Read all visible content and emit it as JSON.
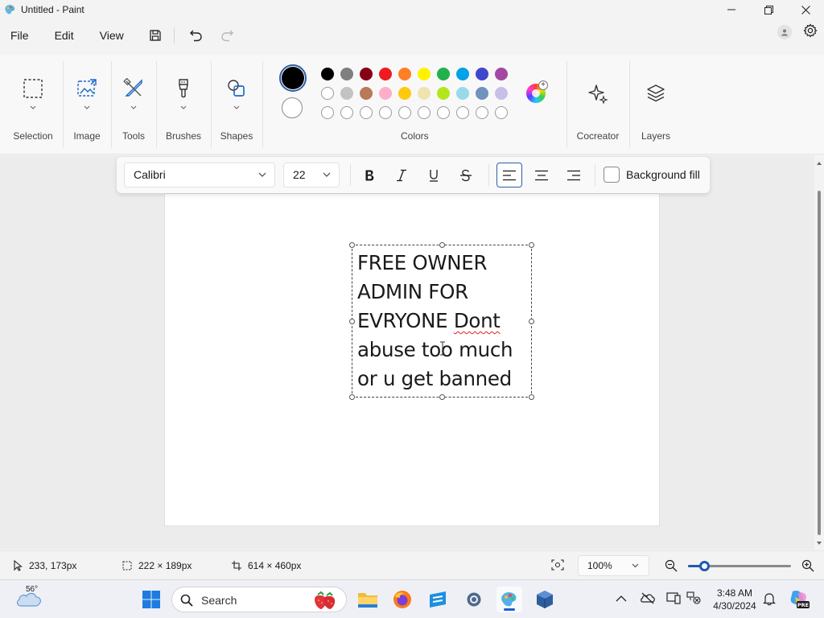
{
  "window": {
    "title": "Untitled - Paint"
  },
  "menu": {
    "items": [
      "File",
      "Edit",
      "View"
    ]
  },
  "ribbon": {
    "groups": {
      "selection": "Selection",
      "image": "Image",
      "tools": "Tools",
      "brushes": "Brushes",
      "shapes": "Shapes",
      "colors": "Colors",
      "cocreator": "Cocreator",
      "layers": "Layers"
    },
    "primary_color": "#000000",
    "secondary_color": "#ffffff",
    "palette_row1": [
      "#000000",
      "#7f7f7f",
      "#880015",
      "#ed1c24",
      "#ff7f27",
      "#fff200",
      "#22b14c",
      "#00a2e8",
      "#3f48cc",
      "#a349a4"
    ],
    "palette_row2": [
      "#ffffff",
      "#c3c3c3",
      "#b97a57",
      "#ffaec9",
      "#ffc90e",
      "#efe4b0",
      "#b5e61d",
      "#99d9ea",
      "#7092be",
      "#c8bfe7"
    ]
  },
  "text_toolbar": {
    "font": "Calibri",
    "size": "22",
    "background_fill_label": "Background fill"
  },
  "canvas": {
    "text_line1": "FREE OWNER",
    "text_line2": "ADMIN FOR",
    "text_line3a": "EVRYONE ",
    "text_line3b": "Dont",
    "text_line4": "abuse too much",
    "text_line5": "or u get banned"
  },
  "status": {
    "cursor_position": "233, 173px",
    "selection_size": "222 × 189px",
    "canvas_size": "614 × 460px",
    "zoom": "100%"
  },
  "zoom_slider_fraction": 0.16,
  "taskbar": {
    "weather_temp": "56°",
    "search_placeholder": "Search",
    "time": "3:48 AM",
    "date": "4/30/2024"
  }
}
